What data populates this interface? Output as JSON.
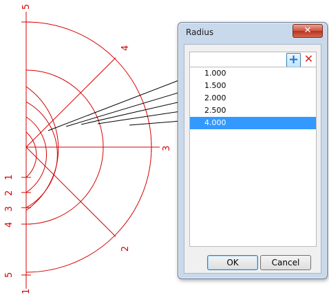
{
  "drawing": {
    "axis_labels": {
      "top": "5",
      "diag_upper": "4",
      "right": "3",
      "diag_lower": "2",
      "left_1": "1",
      "left_2": "2",
      "left_3": "3",
      "left_4": "4",
      "left_5": "5",
      "bottom": "1"
    },
    "colors": {
      "geometry": "#d40000",
      "leaders": "#000000"
    }
  },
  "dialog": {
    "title": "Radius",
    "close_label": "✕",
    "input_value": "",
    "add_icon": "plus-icon",
    "delete_icon": "delete-x-icon",
    "items": [
      {
        "label": "1.000",
        "selected": false
      },
      {
        "label": "1.500",
        "selected": false
      },
      {
        "label": "2.000",
        "selected": false
      },
      {
        "label": "2.500",
        "selected": false
      },
      {
        "label": "4.000",
        "selected": true
      }
    ],
    "ok_label": "OK",
    "cancel_label": "Cancel"
  }
}
